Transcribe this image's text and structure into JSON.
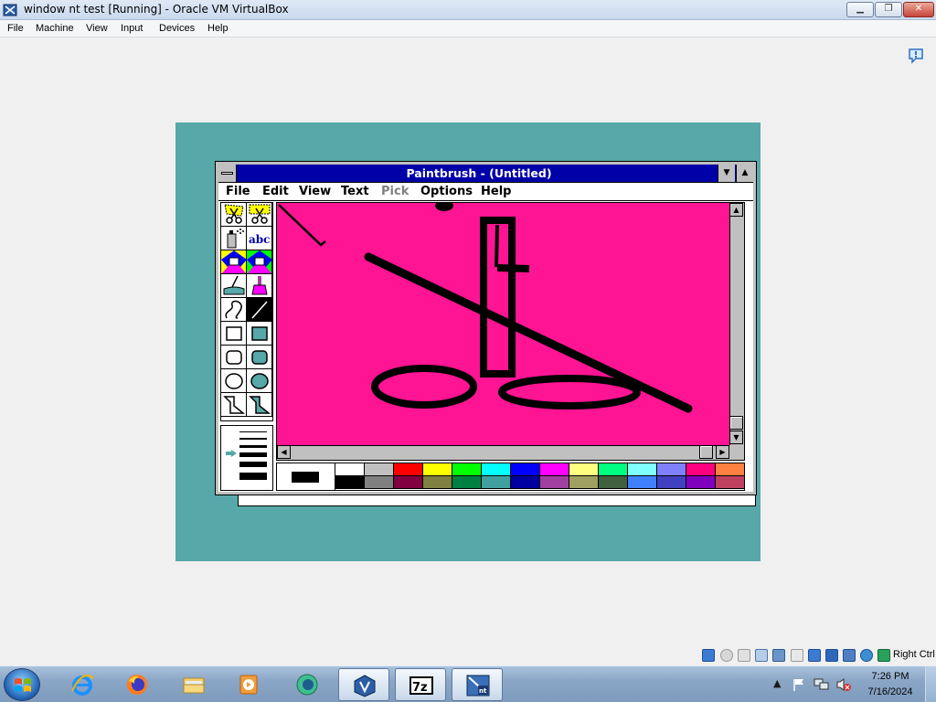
{
  "vbox": {
    "title": "window nt test [Running] - Oracle VM VirtualBox",
    "controls": {
      "minimize": "▁",
      "maximize": "❐",
      "close": "✕"
    },
    "menu": [
      "File",
      "Machine",
      "View",
      "Input",
      "Devices",
      "Help"
    ],
    "host_key_label": "Right Ctrl"
  },
  "paintbrush": {
    "title": "Paintbrush - (Untitled)",
    "menu": [
      {
        "label": "File",
        "enabled": true
      },
      {
        "label": "Edit",
        "enabled": true
      },
      {
        "label": "View",
        "enabled": true
      },
      {
        "label": "Text",
        "enabled": true
      },
      {
        "label": "Pick",
        "enabled": false
      },
      {
        "label": "Options",
        "enabled": true
      },
      {
        "label": "Help",
        "enabled": true
      }
    ],
    "tools": [
      "scissors-tool",
      "pick-tool",
      "airbrush-tool",
      "text-tool",
      "color-eraser-tool",
      "eraser-tool",
      "paint-roller-tool",
      "brush-tool",
      "curve-tool",
      "line-tool",
      "box-tool",
      "filled-box-tool",
      "rounded-box-tool",
      "filled-rounded-box-tool",
      "circle-tool",
      "filled-circle-tool",
      "polygon-tool",
      "filled-polygon-tool"
    ],
    "selected_tool": "line-tool",
    "canvas_background": "#ff1493",
    "foreground_color": "#000000",
    "background_color": "#ffffff",
    "palette": {
      "top": [
        "#ffffff",
        "#c0c0c0",
        "#ff0000",
        "#ffff00",
        "#00ff00",
        "#00ffff",
        "#0000ff",
        "#ff00ff",
        "#ffff80",
        "#00ff80",
        "#80ffff",
        "#8080ff",
        "#ff0080",
        "#ff8040"
      ],
      "bottom": [
        "#000000",
        "#808080",
        "#800040",
        "#808040",
        "#008040",
        "#40a0a0",
        "#0000a0",
        "#a040a0",
        "#a0a060",
        "#406040",
        "#4080ff",
        "#4040c0",
        "#8000c0",
        "#c04060"
      ]
    },
    "scroll_arrows": {
      "up": "▲",
      "down": "▼",
      "left": "◀",
      "right": "▶"
    }
  },
  "guest": {
    "desktop_color": "#57a8a8"
  },
  "taskbar": {
    "clock_time": "7:26 PM",
    "clock_date": "7/16/2024",
    "tray_chevron": "▲",
    "pinned": [
      "internet-explorer",
      "firefox",
      "file-explorer",
      "media-player",
      "ccleaner-style-app",
      "virtualbox",
      "7-zip",
      "windows-nt-vm"
    ]
  }
}
